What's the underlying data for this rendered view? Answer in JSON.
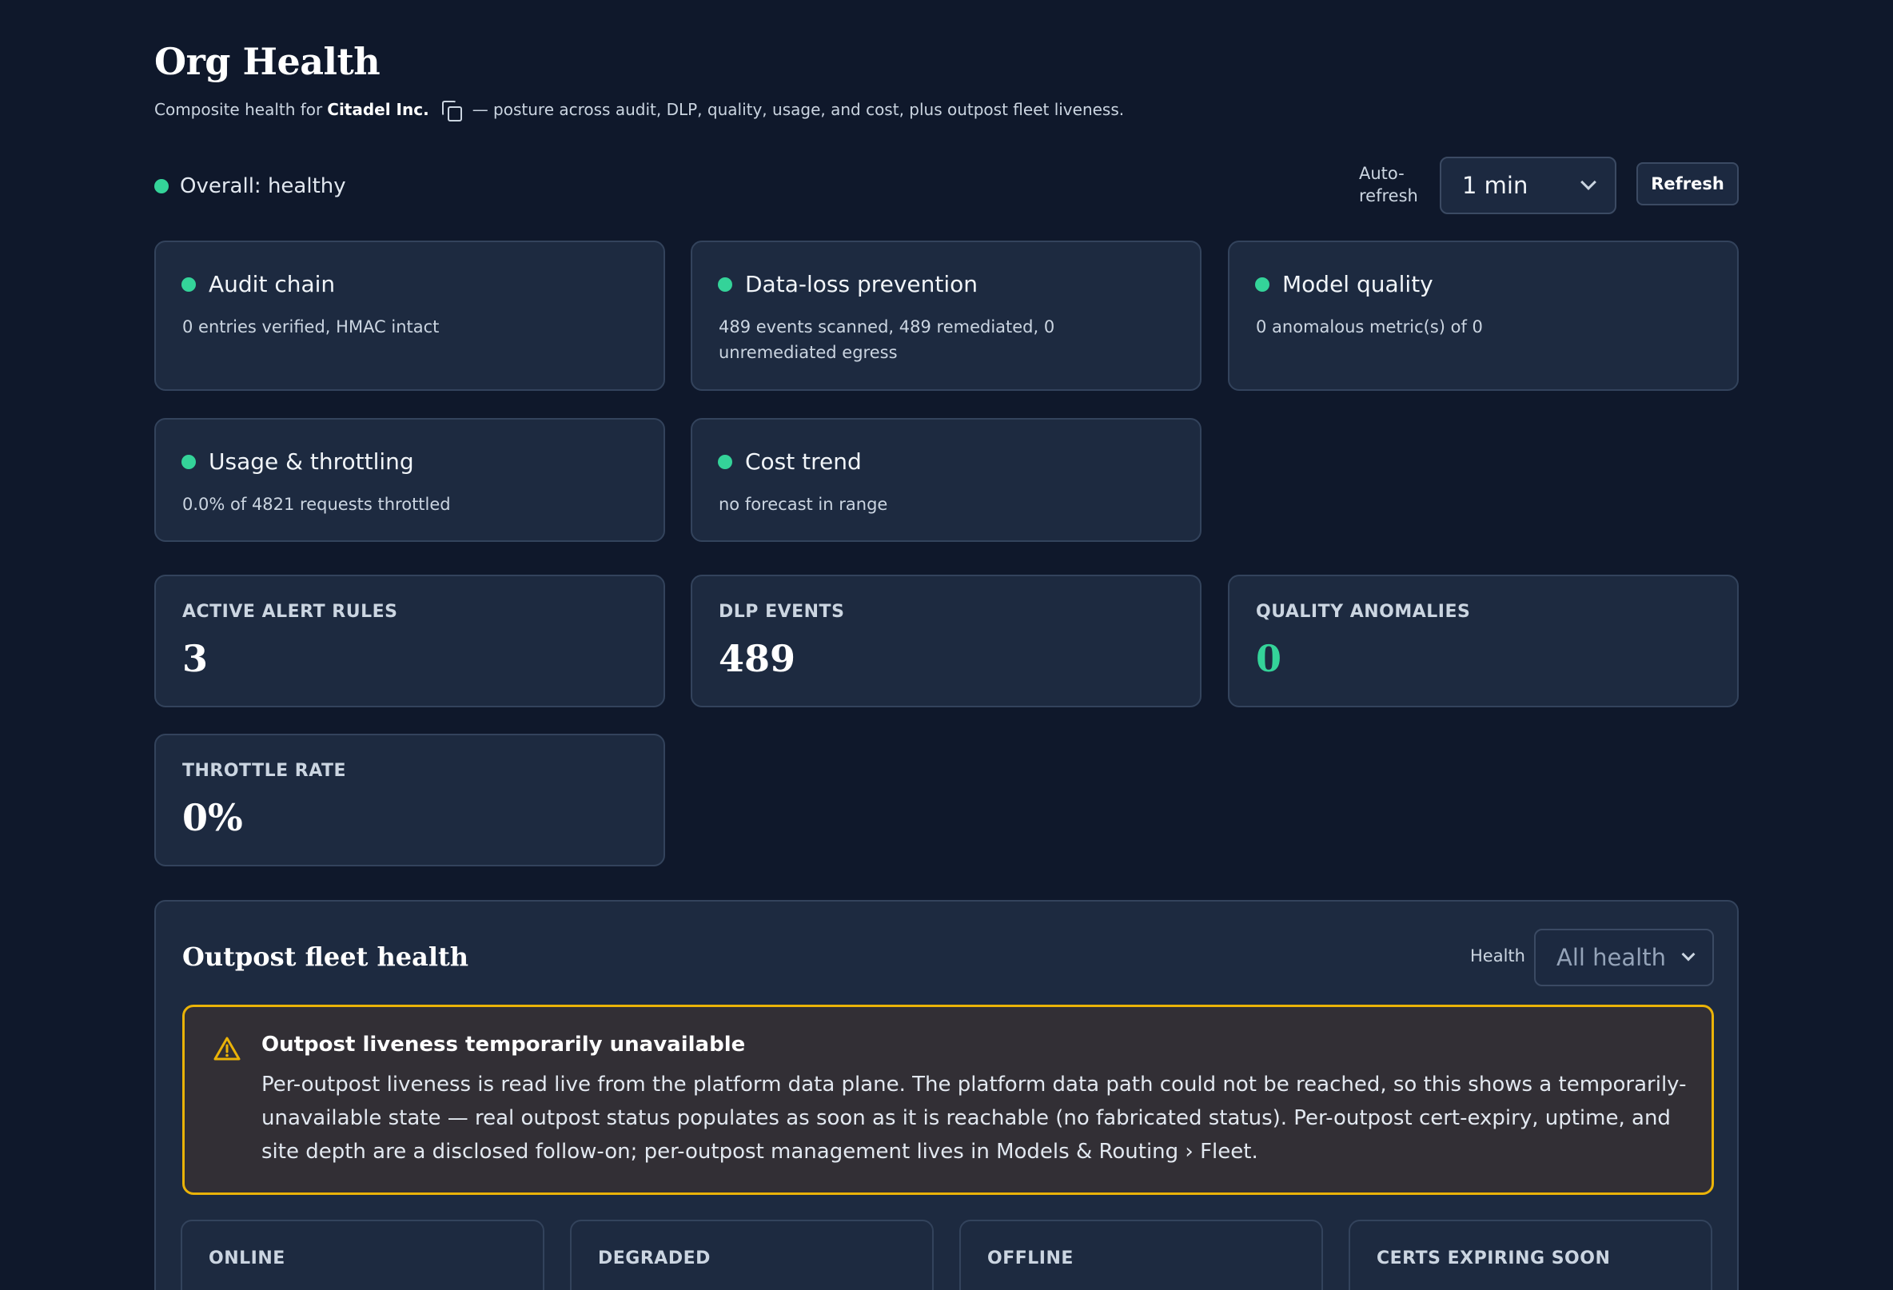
{
  "header": {
    "title": "Org Health",
    "subtitle_prefix": "Composite health for",
    "org_name": "Citadel Inc.",
    "subtitle_suffix": "— posture across audit, DLP, quality, usage, and cost, plus outpost fleet liveness."
  },
  "overall": {
    "label": "Overall: healthy",
    "status_color": "#34d399"
  },
  "controls": {
    "auto_refresh_label": "Auto-\nrefresh",
    "auto_refresh_value": "1 min",
    "refresh_label": "Refresh"
  },
  "health_cards": [
    {
      "title": "Audit chain",
      "desc": "0 entries verified, HMAC intact",
      "status": "healthy"
    },
    {
      "title": "Data-loss prevention",
      "desc": "489 events scanned, 489 remediated, 0 unremediated egress",
      "status": "healthy"
    },
    {
      "title": "Model quality",
      "desc": "0 anomalous metric(s) of 0",
      "status": "healthy"
    },
    {
      "title": "Usage & throttling",
      "desc": "0.0% of 4821 requests throttled",
      "status": "healthy"
    },
    {
      "title": "Cost trend",
      "desc": "no forecast in range",
      "status": "healthy"
    }
  ],
  "stats": [
    {
      "label": "ACTIVE ALERT RULES",
      "value": "3"
    },
    {
      "label": "DLP EVENTS",
      "value": "489"
    },
    {
      "label": "QUALITY ANOMALIES",
      "value": "0"
    },
    {
      "label": "THROTTLE RATE",
      "value": "0%"
    }
  ],
  "fleet": {
    "title": "Outpost fleet health",
    "filter_label": "Health",
    "filter_value": "All health",
    "warning": {
      "title": "Outpost liveness temporarily unavailable",
      "body": "Per-outpost liveness is read live from the platform data plane. The platform data path could not be reached, so this shows a temporarily-unavailable state — real outpost status populates as soon as it is reachable (no fabricated status). Per-outpost cert-expiry, uptime, and site depth are a disclosed follow-on; per-outpost management lives in Models & Routing › Fleet."
    },
    "summary": [
      {
        "label": "ONLINE"
      },
      {
        "label": "DEGRADED"
      },
      {
        "label": "OFFLINE"
      },
      {
        "label": "CERTS EXPIRING SOON"
      }
    ]
  },
  "colors": {
    "background": "#0f182b",
    "card": "#1d2a40",
    "healthy": "#34d399",
    "warning": "#eab308"
  }
}
